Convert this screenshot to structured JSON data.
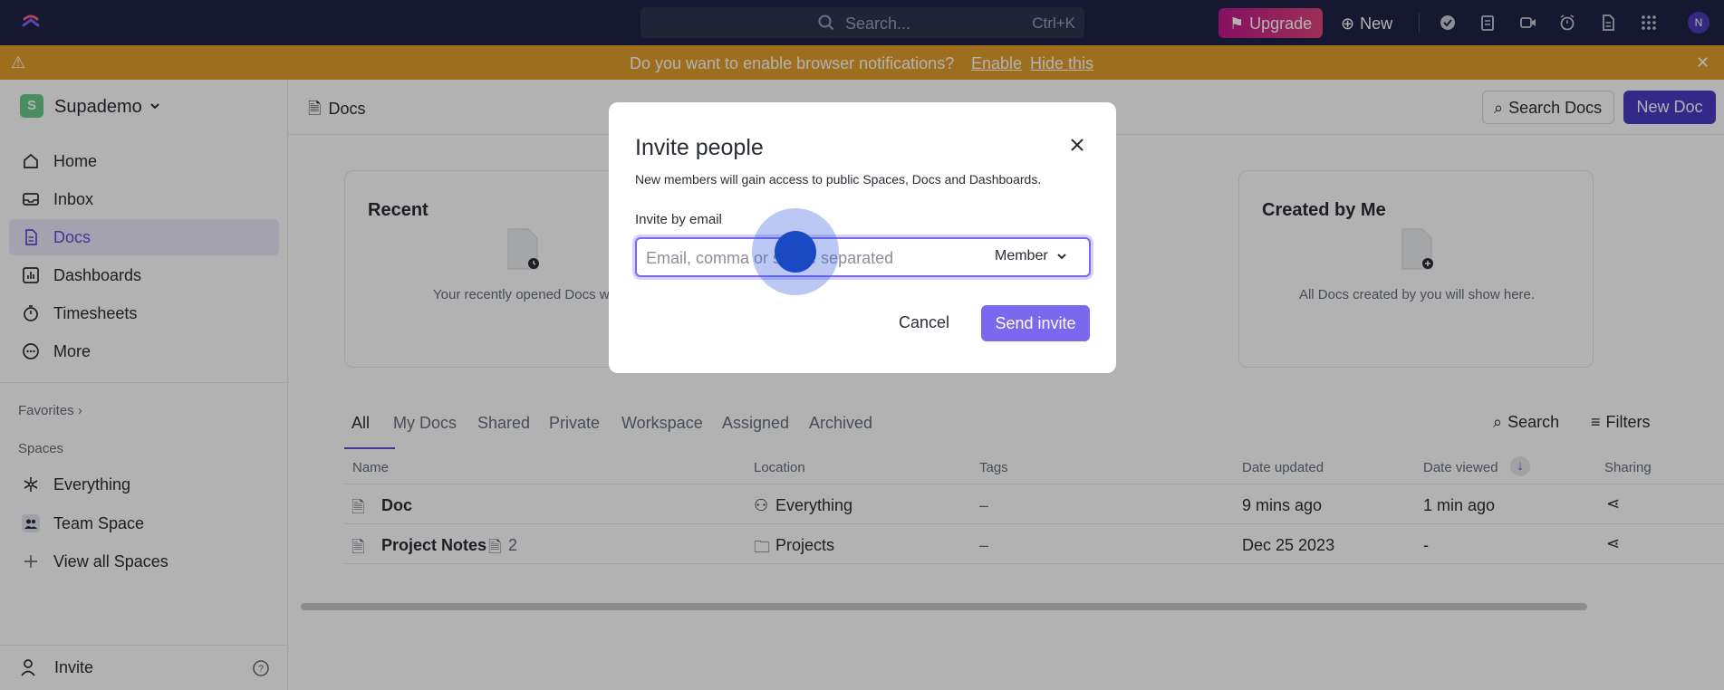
{
  "topbar": {
    "search_placeholder": "Search...",
    "search_shortcut": "Ctrl+K",
    "upgrade_label": "Upgrade",
    "new_label": "New",
    "avatar_initial": "N"
  },
  "notification": {
    "message": "Do you want to enable browser notifications?",
    "enable_label": "Enable",
    "hide_label": "Hide this"
  },
  "sidebar": {
    "workspace_initial": "S",
    "workspace_name": "Supademo",
    "items": [
      {
        "label": "Home",
        "icon": "home-icon"
      },
      {
        "label": "Inbox",
        "icon": "inbox-icon"
      },
      {
        "label": "Docs",
        "icon": "docs-icon",
        "active": true
      },
      {
        "label": "Dashboards",
        "icon": "dashboards-icon"
      },
      {
        "label": "Timesheets",
        "icon": "timesheets-icon"
      },
      {
        "label": "More",
        "icon": "more-icon"
      }
    ],
    "favorites_label": "Favorites",
    "spaces_label": "Spaces",
    "spaces": [
      {
        "label": "Everything",
        "icon": "everything-icon"
      },
      {
        "label": "Team Space",
        "icon": "team-space-icon"
      },
      {
        "label": "View all Spaces",
        "icon": "plus-icon"
      }
    ],
    "invite_label": "Invite"
  },
  "main": {
    "breadcrumb": "Docs",
    "search_docs_label": "Search Docs",
    "new_doc_label": "New Doc",
    "cards": [
      {
        "title": "Recent",
        "desc": "Your recently opened Docs wi"
      },
      {
        "title": "Created by Me",
        "desc": "All Docs created by you will show here."
      }
    ],
    "tabs": [
      "All",
      "My Docs",
      "Shared",
      "Private",
      "Workspace",
      "Assigned",
      "Archived"
    ],
    "search_label": "Search",
    "filters_label": "Filters",
    "columns": [
      "Name",
      "Location",
      "Tags",
      "Date updated",
      "Date viewed",
      "Sharing"
    ],
    "rows": [
      {
        "name": "Doc",
        "sub_count": "",
        "location": "Everything",
        "tags": "–",
        "updated": "9 mins ago",
        "viewed": "1 min ago"
      },
      {
        "name": "Project Notes",
        "sub_count": "2",
        "location": "Projects",
        "tags": "–",
        "updated": "Dec 25 2023",
        "viewed": "-"
      }
    ]
  },
  "modal": {
    "title": "Invite people",
    "subtitle": "New members will gain access to public Spaces, Docs and Dashboards.",
    "email_label": "Invite by email",
    "email_placeholder": "Email, comma or space separated",
    "email_value": "",
    "role": "Member",
    "cancel_label": "Cancel",
    "send_label": "Send invite"
  },
  "colors": {
    "accent": "#7b68ee",
    "topbar": "#1f2345",
    "notification": "#e39e2d",
    "new_doc": "#4b3bc4"
  }
}
